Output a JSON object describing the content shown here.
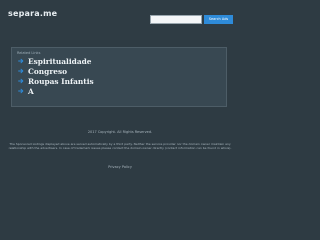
{
  "site": {
    "domain": "separa.me"
  },
  "search": {
    "placeholder": "",
    "button_label": "Search Ads"
  },
  "related": {
    "heading": "Related Links",
    "links": [
      {
        "label": "Espiritualidade"
      },
      {
        "label": "Congreso"
      },
      {
        "label": "Roupas Infantis"
      },
      {
        "label": "A"
      }
    ]
  },
  "footer": {
    "copyright": "2017 Copyright. All Rights Reserved.",
    "disclaimer": "The Sponsored Listings displayed above are served automatically by a third party. Neither the service provider nor the domain owner maintain any relationship with the advertisers. In case of trademark issues please contact the domain owner directly (contact information can be found in whois).",
    "privacy_label": "Privacy Policy"
  },
  "colors": {
    "background": "#2e3b43",
    "panel": "#384852",
    "accent": "#2e8bd9",
    "arrow": "#2e8bd9"
  },
  "icons": {
    "link_arrow": "arrow-right-icon"
  }
}
